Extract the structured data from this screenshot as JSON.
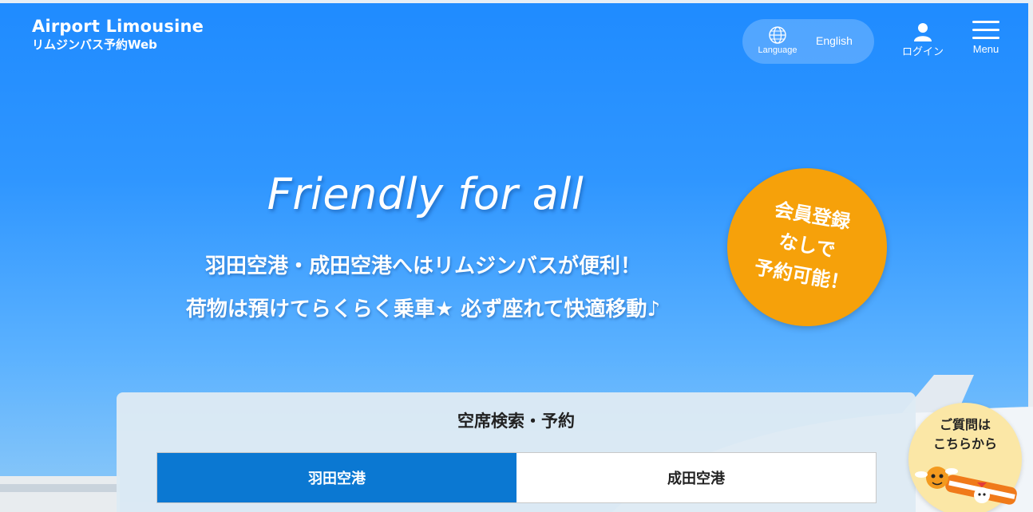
{
  "header": {
    "logo_title": "Airport Limousine",
    "logo_subtitle": "リムジンバス予約Web",
    "language_label": "Language",
    "language_value": "English",
    "login_label": "ログイン",
    "menu_label": "Menu"
  },
  "hero": {
    "tagline": "Friendly for all",
    "line1": "羽田空港・成田空港へはリムジンバスが便利！",
    "line2": "荷物は預けてらくらく乗車★ 必ず座れて快適移動♪",
    "badge_line1": "会員登録",
    "badge_line2": "なしで",
    "badge_line3": "予約可能！"
  },
  "search": {
    "title": "空席検索・予約",
    "tabs": [
      {
        "label": "羽田空港",
        "active": true
      },
      {
        "label": "成田空港",
        "active": false
      }
    ]
  },
  "help": {
    "line1": "ご質問は",
    "line2": "こちらから"
  },
  "colors": {
    "accent_blue": "#0b78d2",
    "badge_orange": "#f6a10a",
    "help_yellow": "#fbe7a6"
  }
}
